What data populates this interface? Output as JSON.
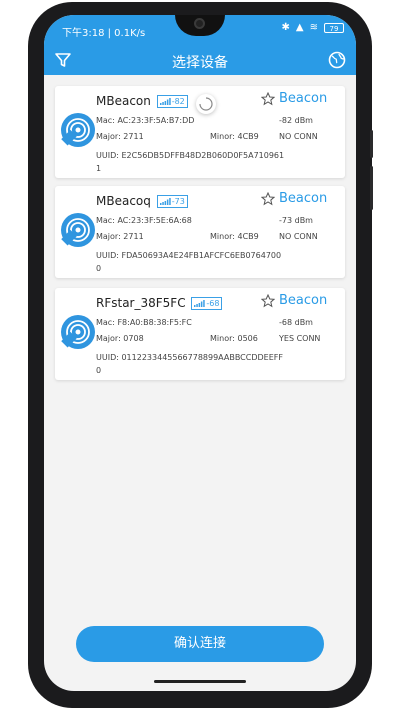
{
  "status_bar": {
    "time_text": "下午3:18 | 0.1K/s",
    "battery": "79"
  },
  "app_bar": {
    "title": "选择设备"
  },
  "devices": [
    {
      "name": "MBeacon",
      "rssi": "-82",
      "type": "Beacon",
      "mac": "Mac: AC:23:3F:5A:B7:DD",
      "rssi_dbm": "-82 dBm",
      "major": "Major: 2711",
      "minor": "Minor: 4CB9",
      "conn": "NO CONN",
      "uuid": "UUID: E2C56DB5DFFB48D2B060D0F5A7109611"
    },
    {
      "name": "MBeacoq",
      "rssi": "-73",
      "type": "Beacon",
      "mac": "Mac: AC:23:3F:5E:6A:68",
      "rssi_dbm": "-73 dBm",
      "major": "Major: 2711",
      "minor": "Minor: 4CB9",
      "conn": "NO CONN",
      "uuid": "UUID: FDA50693A4E24FB1AFCFC6EB07647000"
    },
    {
      "name": "RFstar_38F5FC",
      "rssi": "-68",
      "type": "Beacon",
      "mac": "Mac: F8:A0:B8:38:F5:FC",
      "rssi_dbm": "-68 dBm",
      "major": "Major: 0708",
      "minor": "Minor: 0506",
      "conn": "YES CONN",
      "uuid": "UUID: 0112233445566778899AABBCCDDEEFF0"
    }
  ],
  "confirm_button": {
    "label": "确认连接"
  },
  "colors": {
    "accent": "#2a9be6",
    "background": "#f3f3f3"
  },
  "icons": [
    "filter-icon",
    "globe-icon",
    "wifi-signal-icon",
    "star-icon",
    "signal-bars-icon",
    "loading-spinner-icon"
  ]
}
